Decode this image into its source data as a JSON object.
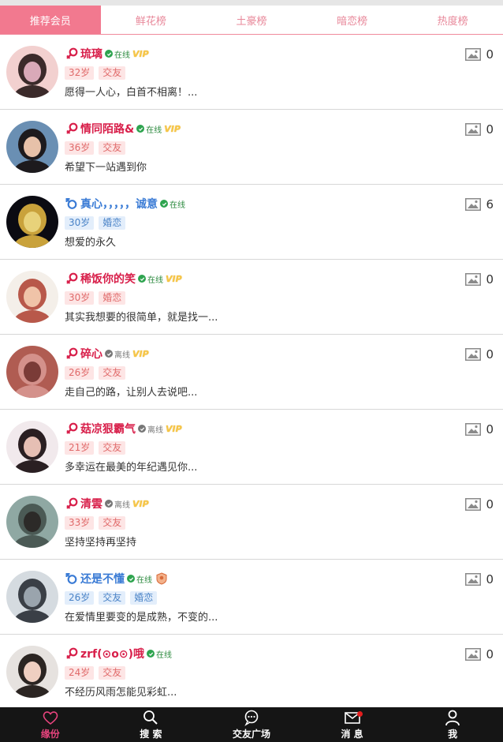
{
  "tabs": [
    "推荐会员",
    "鲜花榜",
    "土豪榜",
    "暗恋榜",
    "热度榜"
  ],
  "active_tab": 0,
  "members": [
    {
      "name": "琉璃",
      "gender": "f",
      "status": "在线",
      "online": true,
      "badge": "vip",
      "tags": [
        "32岁",
        "交友"
      ],
      "bio": "愿得一人心，白首不相离！...",
      "photos": "0",
      "avatar_colors": [
        "#f2d0cf",
        "#3b2a2a",
        "#d9a9b8"
      ]
    },
    {
      "name": "情同陌路&",
      "gender": "f",
      "status": "在线",
      "online": true,
      "badge": "vip",
      "tags": [
        "36岁",
        "交友"
      ],
      "bio": "希望下一站遇到你",
      "photos": "0",
      "avatar_colors": [
        "#6a8fb3",
        "#1d1a1d",
        "#e7c1a9"
      ]
    },
    {
      "name": "真心，，，，，诚意",
      "gender": "m",
      "status": "在线",
      "online": true,
      "badge": "",
      "tags": [
        "30岁",
        "婚恋"
      ],
      "bio": "想爱的永久",
      "photos": "6",
      "avatar_colors": [
        "#0b0b12",
        "#c9a23b",
        "#e8d27a"
      ]
    },
    {
      "name": "稀饭你的笑",
      "gender": "f",
      "status": "在线",
      "online": true,
      "badge": "vip",
      "tags": [
        "30岁",
        "婚恋"
      ],
      "bio": "其实我想要的很简单，就是找一...",
      "photos": "0",
      "avatar_colors": [
        "#f4efe9",
        "#b8584a",
        "#f0c3a8"
      ]
    },
    {
      "name": "碎心",
      "gender": "f",
      "status": "离线",
      "online": false,
      "badge": "vip",
      "tags": [
        "26岁",
        "交友"
      ],
      "bio": "走自己的路，让别人去说吧...",
      "photos": "0",
      "avatar_colors": [
        "#b05c52",
        "#d4918b",
        "#7a3b37"
      ]
    },
    {
      "name": "菇凉狠霸气",
      "gender": "f",
      "status": "离线",
      "online": false,
      "badge": "vip",
      "tags": [
        "21岁",
        "交友"
      ],
      "bio": "多幸运在最美的年纪遇见你...",
      "photos": "0",
      "avatar_colors": [
        "#f1e9ec",
        "#2a1f22",
        "#e6bfb4"
      ]
    },
    {
      "name": "清雲",
      "gender": "f",
      "status": "离线",
      "online": false,
      "badge": "vip",
      "tags": [
        "33岁",
        "交友"
      ],
      "bio": "坚持坚持再坚持",
      "photos": "0",
      "avatar_colors": [
        "#8fa8a3",
        "#4b5a55",
        "#2c2a28"
      ]
    },
    {
      "name": "还是不懂",
      "gender": "m",
      "status": "在线",
      "online": true,
      "badge": "medal",
      "tags": [
        "26岁",
        "交友",
        "婚恋"
      ],
      "bio": "在爱情里要变的是成熟，不变的...",
      "photos": "0",
      "avatar_colors": [
        "#d5dbe0",
        "#3a3f46",
        "#9aa4ad"
      ]
    },
    {
      "name": "zrf(⊙o⊙)哦",
      "gender": "f",
      "status": "在线",
      "online": true,
      "badge": "",
      "tags": [
        "24岁",
        "交友"
      ],
      "bio": "不经历风雨怎能见彩虹...",
      "photos": "0",
      "avatar_colors": [
        "#e6e2df",
        "#2b2522",
        "#efcfc1"
      ]
    }
  ],
  "bottom_nav": [
    {
      "label": "缘份",
      "icon": "heart-icon"
    },
    {
      "label": "搜 索",
      "icon": "search-icon"
    },
    {
      "label": "交友广场",
      "icon": "chat-icon"
    },
    {
      "label": "消 息",
      "icon": "mail-icon"
    },
    {
      "label": "我",
      "icon": "user-icon"
    }
  ],
  "colors": {
    "accent": "#f2798f",
    "female": "#d81f4a",
    "male": "#3a7bd5",
    "online": "#2ea44f"
  }
}
